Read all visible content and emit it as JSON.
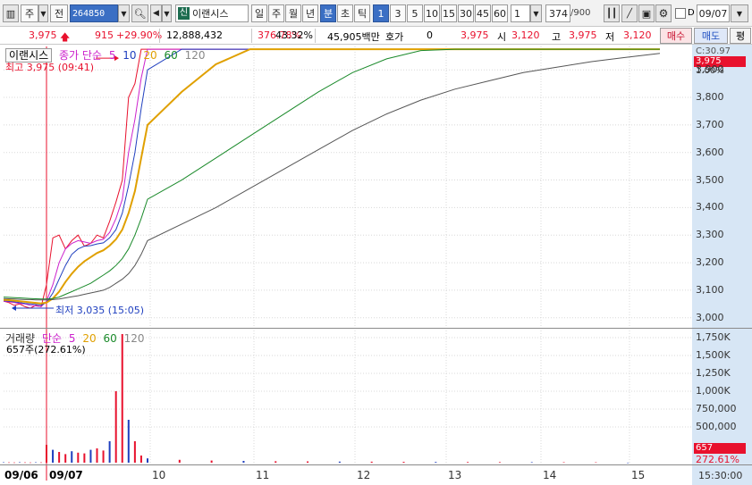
{
  "toolbar": {
    "market": "주",
    "prev_label": "전",
    "stock_code": "264850",
    "stock_name": "이랜시스",
    "shin": "신",
    "period_buttons": [
      "일",
      "주",
      "월",
      "년",
      "분",
      "초",
      "틱"
    ],
    "interval_buttons": [
      "1",
      "3",
      "5",
      "10",
      "15",
      "30",
      "45",
      "60"
    ],
    "interval_value": "1",
    "count_value": "374",
    "count_max": "/900",
    "date_checkbox_label": "D",
    "date_value": "09/07"
  },
  "info": {
    "price": "3,975",
    "change": "915",
    "change_pct": "+29.90%",
    "volume": "12,888,432",
    "volume_ratio": "376.78%",
    "turnover": "43.32%",
    "amount": "45,905백만",
    "hoga_label": "호가",
    "hoga_value": "0",
    "current": "3,975",
    "open_label": "시",
    "open": "3,120",
    "high_label": "고",
    "high": "3,975",
    "low_label": "저",
    "low": "3,120",
    "buy_label": "매수",
    "sell_label": "매도",
    "avg_label": "평"
  },
  "price_pane": {
    "title": "이랜시스",
    "ma_labels": [
      "종가 단순",
      "5",
      "10",
      "20",
      "60",
      "120"
    ],
    "high_marker": "최고 3,975 (09:41)",
    "low_marker": "최저 3,035 (15:05)",
    "axis_top_text": "C:30.97",
    "axis_second_text": "1.00%",
    "current_tag": "3,975",
    "y_labels": [
      "3,900",
      "3,800",
      "3,700",
      "3,600",
      "3,500",
      "3,400",
      "3,300",
      "3,200",
      "3,100",
      "3,000"
    ]
  },
  "volume_pane": {
    "title": "거래량",
    "ma_labels": [
      "단순",
      "5",
      "20",
      "60",
      "120"
    ],
    "current_text": "657주(272.61%)",
    "y_labels": [
      "1,750K",
      "1,500K",
      "1,250K",
      "1,000K",
      "750,000",
      "500,000"
    ],
    "current_tag": "657",
    "ratio_tag": "272.61%"
  },
  "x_axis": {
    "labels": [
      "09/06",
      "09/07",
      "10",
      "11",
      "12",
      "13",
      "14",
      "15"
    ],
    "end_time": "15:30:00"
  },
  "colors": {
    "close_line": "#e8112d",
    "ma5": "#cc22cc",
    "ma10": "#1f3fbf",
    "ma20": "#e0a000",
    "ma60": "#1a8a2a",
    "ma120": "#555555",
    "axis_bg": "#d7e6f5",
    "price_tag": "#e8112d",
    "selected": "#3b6fc4"
  },
  "chart_data": {
    "type": "line",
    "title": "이랜시스",
    "y_axis": {
      "ylim": [
        2970,
        3985
      ]
    },
    "x_labels": [
      "09/06",
      "09/07",
      "10",
      "11",
      "12",
      "13",
      "14",
      "15"
    ],
    "series": [
      {
        "name": "종가",
        "values": [
          3060,
          3055,
          3045,
          3050,
          3040,
          3035,
          3045,
          3040,
          3120,
          3290,
          3300,
          3250,
          3280,
          3300,
          3260,
          3270,
          3300,
          3290,
          3350,
          3420,
          3500,
          3800,
          3850,
          3975,
          3975,
          3975,
          3975,
          3975,
          3975,
          3975,
          3975,
          3975,
          3975,
          3975,
          3975,
          3975,
          3975,
          3975,
          3975,
          3975
        ]
      },
      {
        "name": "5",
        "values": [
          3060,
          3058,
          3055,
          3052,
          3050,
          3045,
          3043,
          3040,
          3060,
          3120,
          3200,
          3250,
          3270,
          3280,
          3275,
          3270,
          3280,
          3285,
          3310,
          3360,
          3430,
          3600,
          3720,
          3870,
          3975,
          3975,
          3975,
          3975,
          3975,
          3975,
          3975,
          3975,
          3975,
          3975,
          3975,
          3975,
          3975,
          3975,
          3975,
          3975
        ]
      },
      {
        "name": "10",
        "values": [
          3062,
          3060,
          3058,
          3055,
          3052,
          3050,
          3048,
          3046,
          3055,
          3090,
          3140,
          3190,
          3230,
          3250,
          3260,
          3262,
          3268,
          3272,
          3290,
          3320,
          3380,
          3480,
          3600,
          3760,
          3900,
          3975,
          3975,
          3975,
          3975,
          3975,
          3975,
          3975,
          3975,
          3975,
          3975,
          3975,
          3975,
          3975,
          3975,
          3975
        ]
      },
      {
        "name": "20",
        "values": [
          3065,
          3064,
          3062,
          3060,
          3058,
          3056,
          3054,
          3052,
          3055,
          3070,
          3095,
          3130,
          3160,
          3185,
          3205,
          3220,
          3235,
          3245,
          3262,
          3285,
          3320,
          3380,
          3460,
          3580,
          3700,
          3820,
          3920,
          3975,
          3975,
          3975,
          3975,
          3975,
          3975,
          3975,
          3975,
          3975,
          3975,
          3975,
          3975,
          3975
        ]
      },
      {
        "name": "60",
        "values": [
          3075,
          3074,
          3073,
          3072,
          3071,
          3070,
          3069,
          3068,
          3068,
          3070,
          3075,
          3085,
          3095,
          3105,
          3115,
          3125,
          3140,
          3155,
          3170,
          3190,
          3215,
          3250,
          3300,
          3360,
          3430,
          3500,
          3580,
          3660,
          3740,
          3820,
          3890,
          3940,
          3970,
          3975,
          3975,
          3975,
          3975,
          3975,
          3975,
          3975
        ]
      },
      {
        "name": "120",
        "values": [
          3070,
          3069,
          3068,
          3067,
          3066,
          3066,
          3065,
          3065,
          3065,
          3066,
          3068,
          3072,
          3076,
          3080,
          3085,
          3090,
          3095,
          3100,
          3110,
          3125,
          3140,
          3160,
          3190,
          3230,
          3280,
          3340,
          3400,
          3470,
          3540,
          3610,
          3680,
          3740,
          3790,
          3830,
          3860,
          3890,
          3910,
          3930,
          3945,
          3960
        ]
      }
    ],
    "volume": {
      "ylim": [
        0,
        1850000
      ],
      "values": [
        5000,
        4000,
        3000,
        6000,
        4000,
        3000,
        5000,
        4000,
        250000,
        180000,
        150000,
        120000,
        160000,
        140000,
        130000,
        180000,
        200000,
        170000,
        300000,
        1000000,
        1800000,
        600000,
        300000,
        100000,
        60000,
        40000,
        30000,
        25000,
        20000,
        18000,
        15000,
        14000,
        12000,
        10000,
        9000,
        8000,
        7000,
        6000,
        5000,
        657
      ]
    }
  }
}
